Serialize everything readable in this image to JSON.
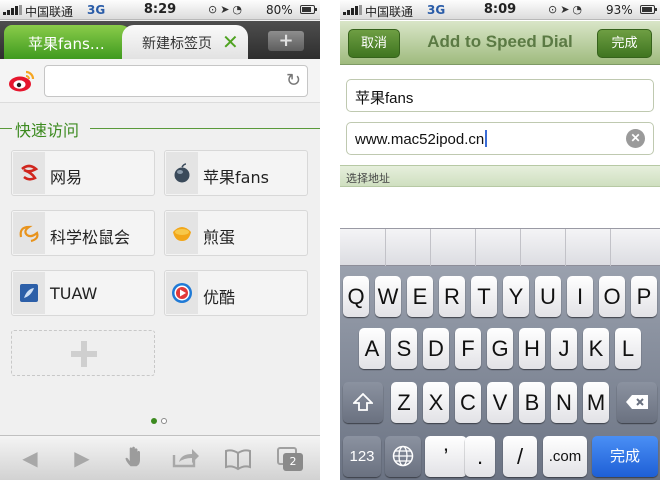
{
  "left": {
    "status": {
      "carrier": "中国联通",
      "network": "3G",
      "time": "8:29",
      "battery": "80%",
      "battery_level": 0.8
    },
    "tabs": [
      {
        "label": "苹果fans…",
        "active": false
      },
      {
        "label": "新建标签页",
        "active": true
      }
    ],
    "new_tab_label": "+",
    "address_placeholder": "",
    "section_title": "快速访问",
    "speed_dials": [
      {
        "label": "网易",
        "icon": "netease-icon"
      },
      {
        "label": "苹果fans",
        "icon": "apple-icon"
      },
      {
        "label": "科学松鼠会",
        "icon": "squirrel-icon"
      },
      {
        "label": "煎蛋",
        "icon": "jiandan-icon"
      },
      {
        "label": "TUAW",
        "icon": "tuaw-icon"
      },
      {
        "label": "优酷",
        "icon": "youku-icon"
      }
    ],
    "page_count": "2",
    "page_indicator": {
      "pages": 2,
      "current": 1
    },
    "colors": {
      "accent": "#4fa321",
      "tab_active": "#3f9a1f",
      "section": "#3c8a1f"
    }
  },
  "right": {
    "status": {
      "carrier": "中国联通",
      "network": "3G",
      "time": "8:09",
      "battery": "93%",
      "battery_level": 0.93
    },
    "nav": {
      "cancel": "取消",
      "title": "Add to Speed Dial",
      "done": "完成"
    },
    "name_field": "苹果fans",
    "url_field": "www.mac52ipod.cn",
    "select_address": "选择地址",
    "keyboard": {
      "row1": [
        "Q",
        "W",
        "E",
        "R",
        "T",
        "Y",
        "U",
        "I",
        "O",
        "P"
      ],
      "row2": [
        "A",
        "S",
        "D",
        "F",
        "G",
        "H",
        "J",
        "K",
        "L"
      ],
      "row3": [
        "Z",
        "X",
        "C",
        "V",
        "B",
        "N",
        "M"
      ],
      "num_key": "123",
      "apostrophe": "’",
      "dot": ".",
      "slash": "/",
      "dotcom": ".com",
      "done": "完成"
    },
    "colors": {
      "nav_button": "#4f8a2c",
      "return_key": "#1e5fd6"
    }
  }
}
